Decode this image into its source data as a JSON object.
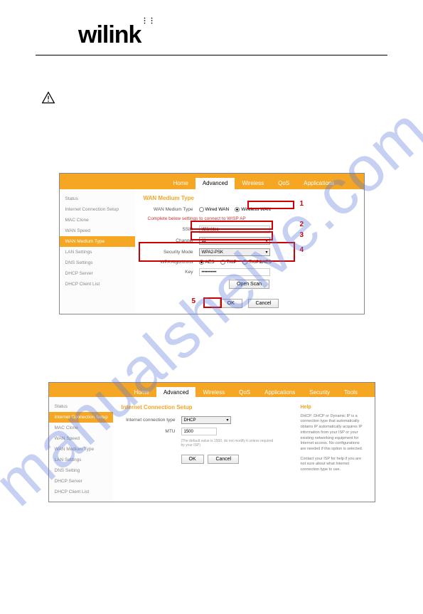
{
  "logo": "wilink",
  "watermark": "manualshelve.com",
  "screenshot1": {
    "tabs": [
      "Home",
      "Advanced",
      "Wireless",
      "QoS",
      "Applications"
    ],
    "activeTab": "Advanced",
    "sidebar": [
      "Status",
      "Internet Connection Setup",
      "MAC Clone",
      "WAN Speed",
      "WAN Medium Type",
      "LAN Settings",
      "DNS Settings",
      "DHCP Server",
      "DHCP Client List"
    ],
    "sidebarActive": "WAN Medium Type",
    "panelTitle": "WAN Medium Type",
    "labels": {
      "wanMedium": "WAN Medium Type",
      "wired": "Wired WAN",
      "wireless": "Wireless WAN",
      "complete": "Complete below settings to connect to WISP AP",
      "ssid": "SSID",
      "channel": "Channel",
      "security": "Security Mode",
      "wpaAlg": "WPA Algorithms",
      "aes": "AES",
      "tkip": "TKIP",
      "tkipaes": "TKIP&AES",
      "key": "Key",
      "openScan": "Open Scan",
      "ok": "OK",
      "cancel": "Cancel"
    },
    "values": {
      "ssid": "Wilinktec",
      "channel": "11",
      "security": "WPA2-PSK",
      "key": "••••••••••"
    },
    "callouts": {
      "n1": "1",
      "n2": "2",
      "n3": "3",
      "n4": "4",
      "n5": "5"
    }
  },
  "screenshot2": {
    "tabs": [
      "Home",
      "Advanced",
      "Wireless",
      "QoS",
      "Applications",
      "Security",
      "Tools"
    ],
    "activeTab": "Advanced",
    "sidebar": [
      "Status",
      "Internet Connection Setup",
      "MAC Clone",
      "WAN Speed",
      "WAN Medium Type",
      "LAN Settings",
      "DNS Setting",
      "DHCP Server",
      "DHCP Client List"
    ],
    "sidebarActive": "Internet Connection Setup",
    "panelTitle": "Internet Connection Setup",
    "labels": {
      "connType": "Internet connection type",
      "mtu": "MTU",
      "note": "(The default value is 1500, do not modify it unless required by your ISP)",
      "ok": "OK",
      "cancel": "Cancel"
    },
    "values": {
      "connType": "DHCP",
      "mtu": "1500"
    },
    "help": {
      "title": "Help",
      "body1": "DHCP: DHCP or Dynamic IP is a connection type that automatically obtains IP automatically acquires IP information from your ISP or your existing networking equipment for Internet access. No configurations are needed if this option is selected.",
      "body2": "Contact your ISP for help if you are not sure about what Internet connection type to use."
    }
  }
}
